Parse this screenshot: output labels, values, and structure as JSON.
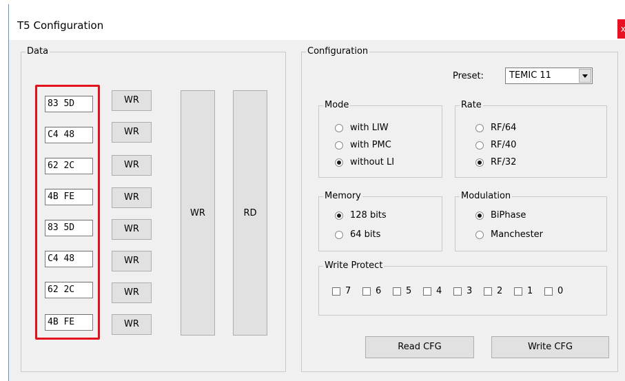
{
  "window": {
    "title": "T5 Configuration",
    "close_label": "x"
  },
  "data_group": {
    "legend": "Data",
    "hex_rows": [
      "83 5D",
      "C4 48",
      "62 2C",
      "4B FE",
      "83 5D",
      "C4 48",
      "62 2C",
      "4B FE"
    ],
    "wr_label": "WR",
    "big_wr_label": "WR",
    "big_rd_label": "RD"
  },
  "config_group": {
    "legend": "Configuration",
    "preset_label": "Preset:",
    "preset_value": "TEMIC 11",
    "mode": {
      "legend": "Mode",
      "options": [
        {
          "label": "with LIW",
          "selected": false
        },
        {
          "label": "with PMC",
          "selected": false
        },
        {
          "label": "without LI",
          "selected": true
        }
      ]
    },
    "rate": {
      "legend": "Rate",
      "options": [
        {
          "label": "RF/64",
          "selected": false
        },
        {
          "label": "RF/40",
          "selected": false
        },
        {
          "label": "RF/32",
          "selected": true
        }
      ]
    },
    "memory": {
      "legend": "Memory",
      "options": [
        {
          "label": "128 bits",
          "selected": true
        },
        {
          "label": "64 bits",
          "selected": false
        }
      ]
    },
    "modulation": {
      "legend": "Modulation",
      "options": [
        {
          "label": "BiPhase",
          "selected": true
        },
        {
          "label": "Manchester",
          "selected": false
        }
      ]
    },
    "write_protect": {
      "legend": "Write Protect",
      "bits": [
        "7",
        "6",
        "5",
        "4",
        "3",
        "2",
        "1",
        "0"
      ]
    },
    "read_button": "Read CFG",
    "write_button": "Write CFG"
  },
  "colors": {
    "highlight": "#e3101b",
    "close": "#e81123"
  }
}
